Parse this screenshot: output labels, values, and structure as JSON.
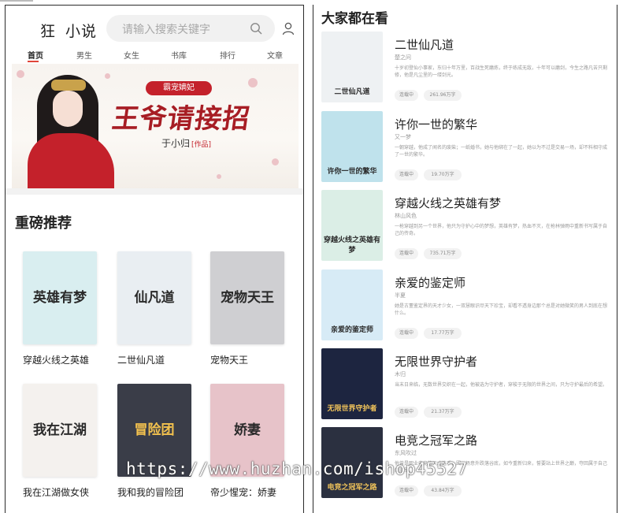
{
  "left": {
    "logo": [
      "狂",
      "小说"
    ],
    "search_placeholder": "请输入搜索关键字",
    "nav": [
      "首页",
      "男生",
      "女生",
      "书库",
      "排行",
      "文章"
    ],
    "banner": {
      "badge": "霸宠嫡妃",
      "title": "王爷请接招",
      "author": "于小归",
      "author_tag": "[作品]"
    },
    "section_title": "重磅推荐",
    "books": [
      {
        "name": "穿越火线之英雄",
        "cover_text": "英雄有梦",
        "color": "#d9eef0"
      },
      {
        "name": "二世仙凡道",
        "cover_text": "仙凡道",
        "color": "#e9eef2"
      },
      {
        "name": "宠物天王",
        "cover_text": "宠物天王",
        "color": "#cfcfd2"
      },
      {
        "name": "我在江湖做女侠",
        "cover_text": "我在江湖",
        "color": "#f4f1ee"
      },
      {
        "name": "我和我的冒险团",
        "cover_text": "冒险团",
        "color": "#3a3d48"
      },
      {
        "name": "帝少惺宠：娇妻",
        "cover_text": "娇妻",
        "color": "#e7c3c9"
      }
    ]
  },
  "right": {
    "title": "大家都在看",
    "items": [
      {
        "title": "二世仙凡道",
        "author": "楚之问",
        "desc": "十岁初登仙小事家，东归十年万里，百战生死磨炼，终于练成无敌，十年可以磨剑，今生之路凡苦只剩修，他是凡尘里的一缕剑光。",
        "tag1": "连载中",
        "tag2": "261.96万字",
        "color": "#eef1f3"
      },
      {
        "title": "许你一世的繁华",
        "author": "又一梦",
        "desc": "一朝穿越，他成了闻名的废柴；一纸婚书，她与他绑在了一起，她以为不过是交易一场，却不料相守成了一世的繁华。",
        "tag1": "连载中",
        "tag2": "19.70万字",
        "color": "#bfe2ec"
      },
      {
        "title": "穿越火线之英雄有梦",
        "author": "林山风色",
        "desc": "一枪穿越到另一个世界，他只为守护心中的梦想，英雄有梦，热血不灭，在枪林弹雨中重新书写属于自己的传奇。",
        "tag1": "连载中",
        "tag2": "735.71万字",
        "color": "#dbeee6"
      },
      {
        "title": "亲爱的鉴定师",
        "author": "半夏",
        "desc": "她是古董鉴定界的天才少女，一双慧眼识尽天下珍宝，却看不透身边那个总是对她微笑的男人到底在想什么。",
        "tag1": "连载中",
        "tag2": "17.77万字",
        "color": "#d7ebf6"
      },
      {
        "title": "无限世界守护者",
        "author": "木归",
        "desc": "当末日来临，无数世界交织在一起，他被选为守护者，穿梭于无限的世界之间，只为守护最后的希望。",
        "tag1": "连载中",
        "tag2": "21.37万字",
        "color": "#1d2540"
      },
      {
        "title": "电竞之冠军之路",
        "author": "东风吹过",
        "desc": "他曾是职业电竞的天才选手，因一场意外跌落谷底，如今重新归来，誓要站上世界之巅，夺回属于自己的冠军。",
        "tag1": "连载中",
        "tag2": "43.84万字",
        "color": "#2b3040"
      }
    ]
  },
  "watermark": "https://www.huzhan.com/ishop45527"
}
